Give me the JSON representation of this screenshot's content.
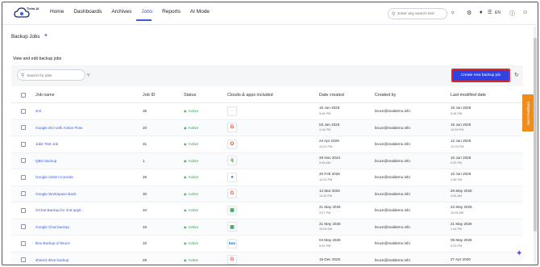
{
  "header": {
    "logo_text": "Tieha AI",
    "nav": [
      "Home",
      "Dashboards",
      "Archives",
      "Jobs",
      "Reports",
      "AI Mode"
    ],
    "active_nav": "Jobs",
    "search_placeholder": "Enter any search text",
    "language": "EN"
  },
  "page": {
    "title": "Backup Jobs",
    "subtitle": "View and edit backup jobs"
  },
  "toolbar": {
    "search_placeholder": "Search for jobs",
    "create_button": "Create new backup job"
  },
  "table": {
    "headers": [
      "Job name",
      "Job ID",
      "Status",
      "Clouds & apps included",
      "Date created",
      "Created by",
      "Last modified date"
    ],
    "rows": [
      {
        "name": "sml",
        "id": "35",
        "status": "Active",
        "app": "generic",
        "app_glyph": "◌",
        "app_color": "#e8b4a0",
        "created_date": "15 Jun 2026",
        "created_time": "5:46 PM",
        "by": "bruce@realdemo.info",
        "mod_date": "15 Jun 2026",
        "mod_time": "5:46 PM"
      },
      {
        "name": "Google DCI with Action Flow",
        "id": "20",
        "status": "Active",
        "app": "google",
        "app_glyph": "G",
        "app_color": "#ea4335",
        "created_date": "03 Jan 2025",
        "created_time": "4:18 PM",
        "by": "bruce@realdemo.info",
        "mod_date": "15 Jun 2026",
        "mod_time": "12:39 PM"
      },
      {
        "name": "Jabir Test Job",
        "id": "31",
        "status": "Active",
        "app": "office365",
        "app_glyph": "O",
        "app_color": "#e64a19",
        "created_date": "24 Apr 2026",
        "created_time": "12:22 PM",
        "by": "bruce@realdemo.info",
        "mod_date": "12 Jun 2026",
        "mod_time": "12:15 PM"
      },
      {
        "name": "QBO backup",
        "id": "1",
        "status": "Active",
        "app": "quickbooks",
        "app_glyph": "q",
        "app_color": "#2ca01c",
        "created_date": "29 Nov 2024",
        "created_time": "9:35 AM",
        "by": "bruce@realdemo.info",
        "mod_date": "10 Jun 2026",
        "mod_time": "5:25 PM"
      },
      {
        "name": "Google Admin Console",
        "id": "26",
        "status": "Active",
        "app": "googleadmin",
        "app_glyph": "●",
        "app_color": "#1e88e5",
        "created_date": "20 Feb 2026",
        "created_time": "12:43 PM",
        "by": "bruce@realdemo.info",
        "mod_date": "10 Jun 2026",
        "mod_time": "4:36 PM"
      },
      {
        "name": "Google Workspace Back",
        "id": "30",
        "status": "Active",
        "app": "google",
        "app_glyph": "G",
        "app_color": "#ea4335",
        "created_date": "14 Mar 2026",
        "created_time": "12:43 PM",
        "by": "bruce@realdemo.info",
        "mod_date": "26 May 2026",
        "mod_time": "4:06 AM"
      },
      {
        "name": "GChat Backup for 2nd appli...",
        "id": "34",
        "status": "Active",
        "app": "gchat",
        "app_glyph": "▣",
        "app_color": "#34a853",
        "created_date": "21 May 2026",
        "created_time": "4:07 PM",
        "by": "bruce@realdemo.info",
        "mod_date": "22 May 2026",
        "mod_time": "10:08 AM"
      },
      {
        "name": "Google Chat backup",
        "id": "33",
        "status": "Active",
        "app": "gchat",
        "app_glyph": "▣",
        "app_color": "#34a853",
        "created_date": "21 May 2026",
        "created_time": "10:00 AM",
        "by": "bruce@realdemo.info",
        "mod_date": "21 May 2026",
        "mod_time": "1:44 PM"
      },
      {
        "name": "Box Backup of Bruce",
        "id": "32",
        "status": "Active",
        "app": "box",
        "app_glyph": "box",
        "app_color": "#0061d5",
        "created_date": "04 May 2026",
        "created_time": "5:00 PM",
        "by": "bruce@realdemo.info",
        "mod_date": "05 May 2026",
        "mod_time": "5:33 PM"
      },
      {
        "name": "shared drive backup",
        "id": "28",
        "status": "Active",
        "app": "google",
        "app_glyph": "G",
        "app_color": "#ea4335",
        "created_date": "15 Dec 2025",
        "created_time": "",
        "by": "bruce@realdemo.info",
        "mod_date": "27 Apr 2026",
        "mod_time": ""
      }
    ]
  },
  "feedback_label": "Send Feedback"
}
